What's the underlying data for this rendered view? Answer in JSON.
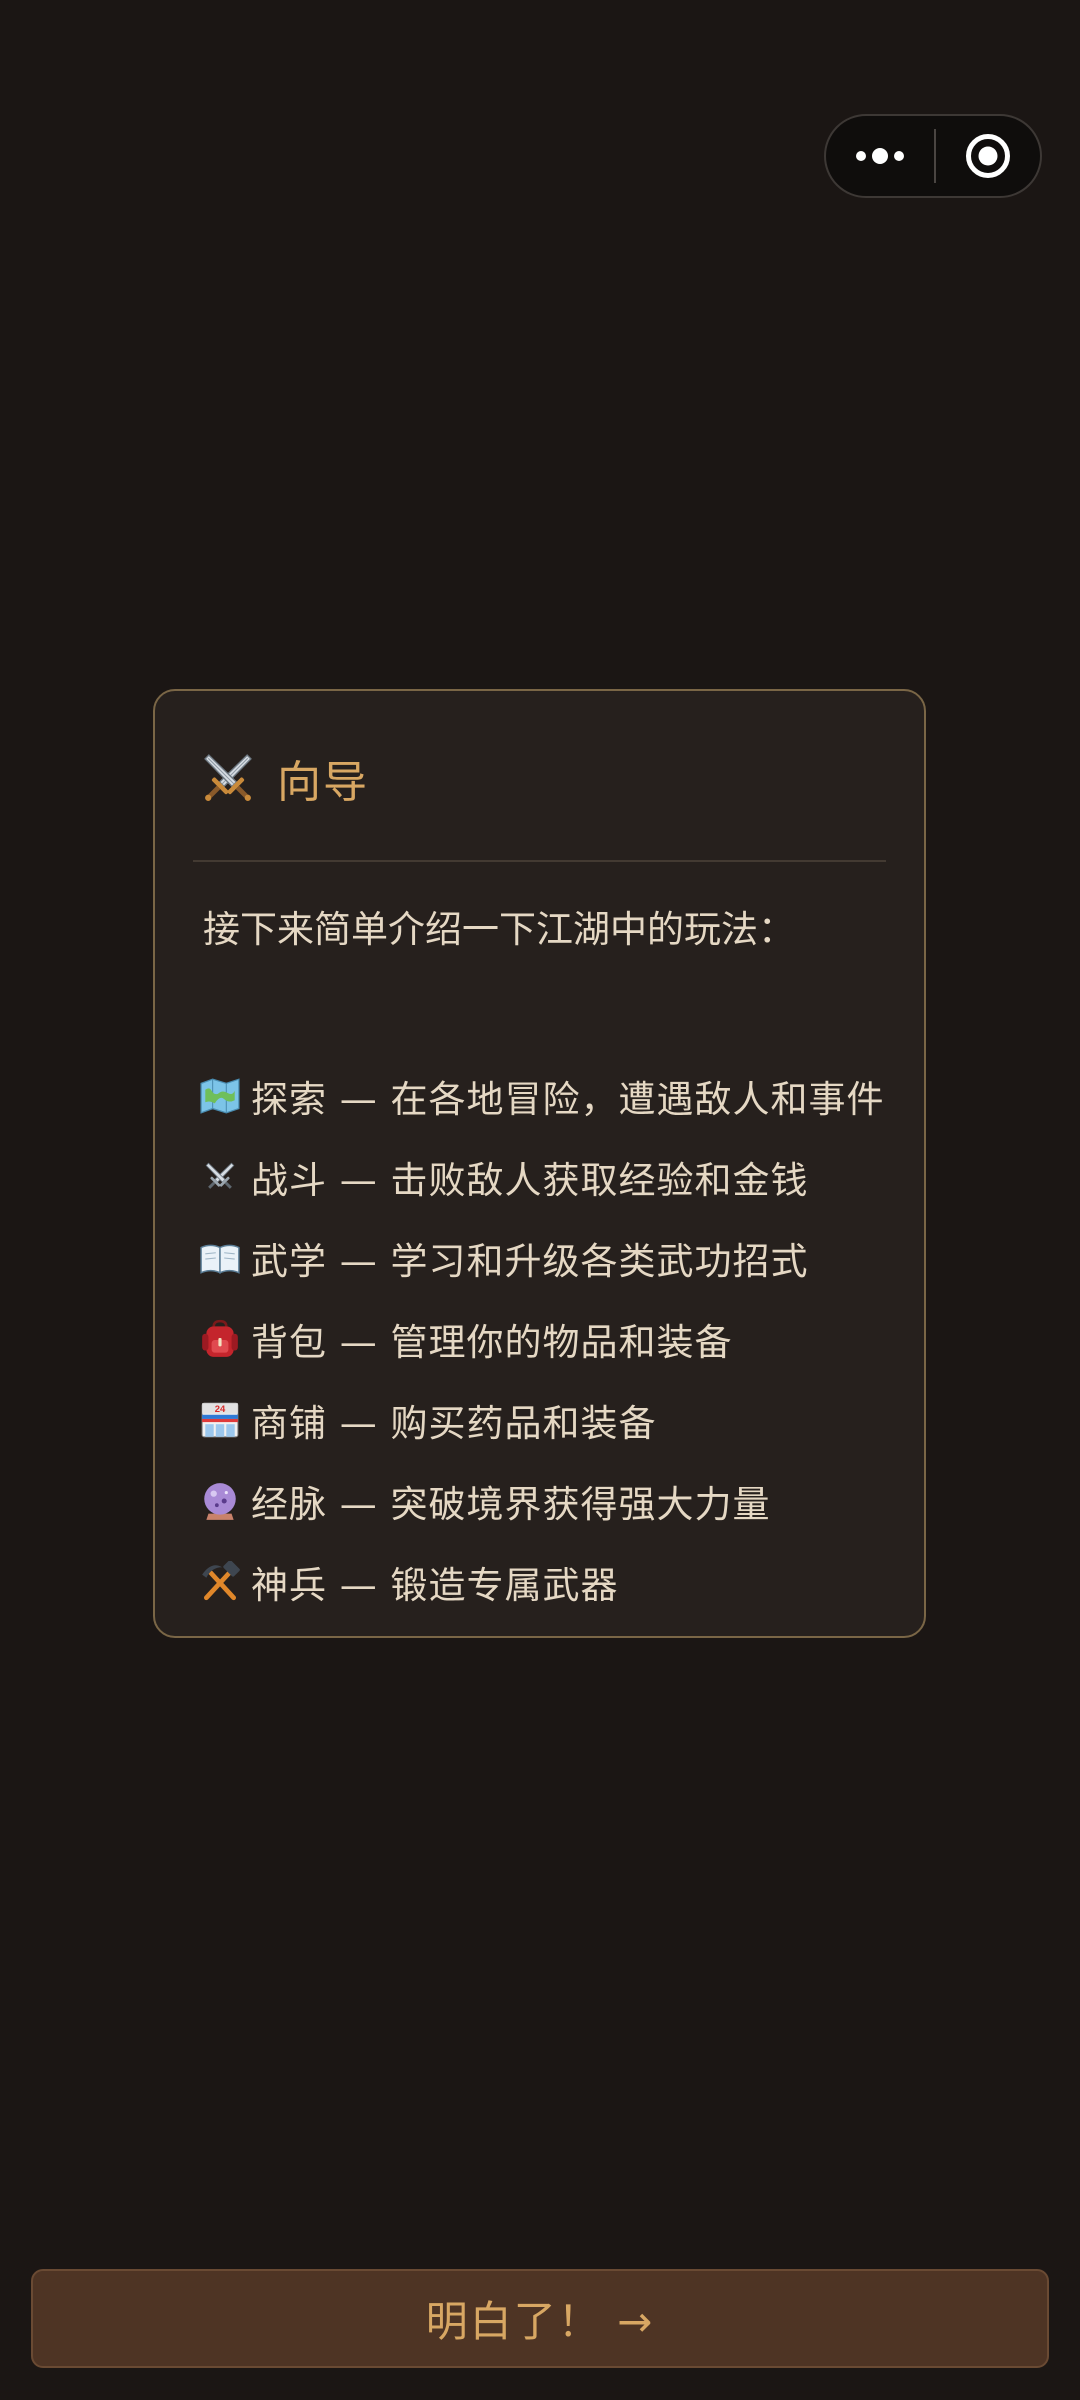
{
  "capsule": {
    "more_icon": "more-dots-icon",
    "close_icon": "close-target-icon"
  },
  "guide": {
    "title_icon": "crossed-swords-icon",
    "title": "向导",
    "intro": "接下来简单介绍一下江湖中的玩法：",
    "items": [
      {
        "icon": "map-icon",
        "text": "探索 — 在各地冒险，遭遇敌人和事件"
      },
      {
        "icon": "crossed-swords-icon",
        "text": "战斗 — 击败敌人获取经验和金钱"
      },
      {
        "icon": "open-book-icon",
        "text": "武学 — 学习和升级各类武功招式"
      },
      {
        "icon": "backpack-icon",
        "text": "背包 — 管理你的物品和装备"
      },
      {
        "icon": "convenience-store-icon",
        "text": "商铺 — 购买药品和装备"
      },
      {
        "icon": "crystal-ball-icon",
        "text": "经脉 — 突破境界获得强大力量"
      },
      {
        "icon": "hammer-pick-icon",
        "text": "神兵 — 锻造专属武器"
      }
    ]
  },
  "confirm_button": {
    "label": "明白了！ →"
  },
  "colors": {
    "background": "#1b1614",
    "card_background": "#26201d",
    "card_border": "#7a6646",
    "accent_gold": "#d8a763",
    "text": "#e5d8c4",
    "button_background": "#4e3424"
  }
}
